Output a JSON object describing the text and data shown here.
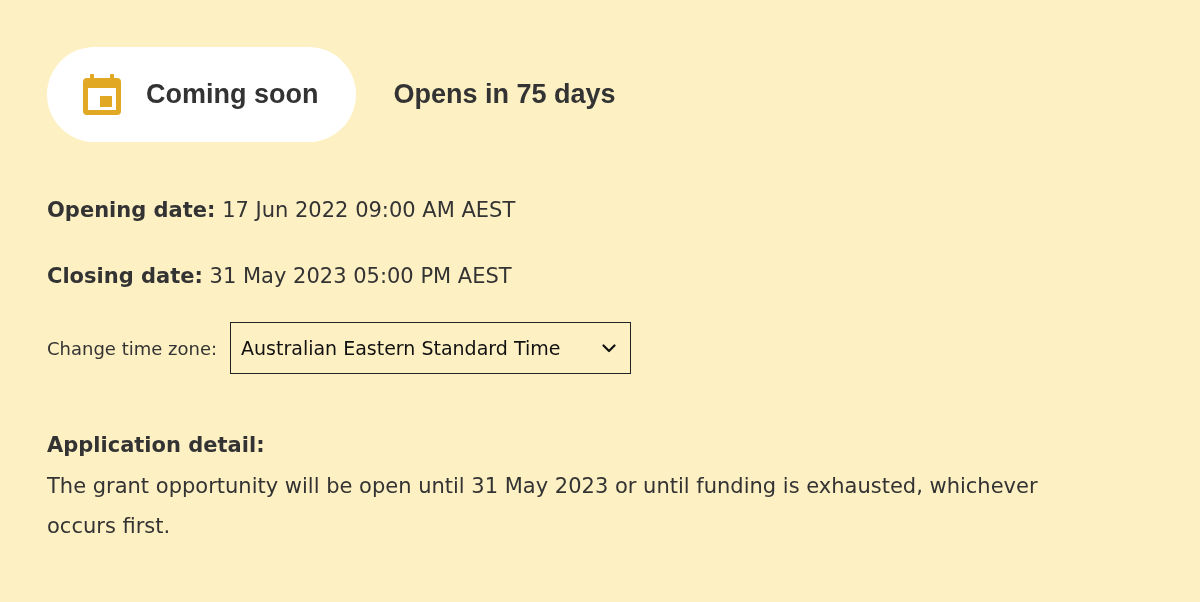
{
  "status": {
    "badge": "Coming soon",
    "countdown": "Opens in 75 days"
  },
  "dates": [
    {
      "text": "**Opening date:** 17 Jun 2022 09:00 AM AEST"
    },
    {
      "text": "**Closing date:** 31 May 2023 05:00 PM AEST"
    }
  ],
  "time_zone": {
    "label": "Change time zone:",
    "value": "Australian Eastern Standard Time"
  },
  "application_detail": {
    "heading": "Application detail:",
    "text": "The grant opportunity will be open until 31 May 2023 or until funding is exhausted, whichever occurs first."
  }
}
